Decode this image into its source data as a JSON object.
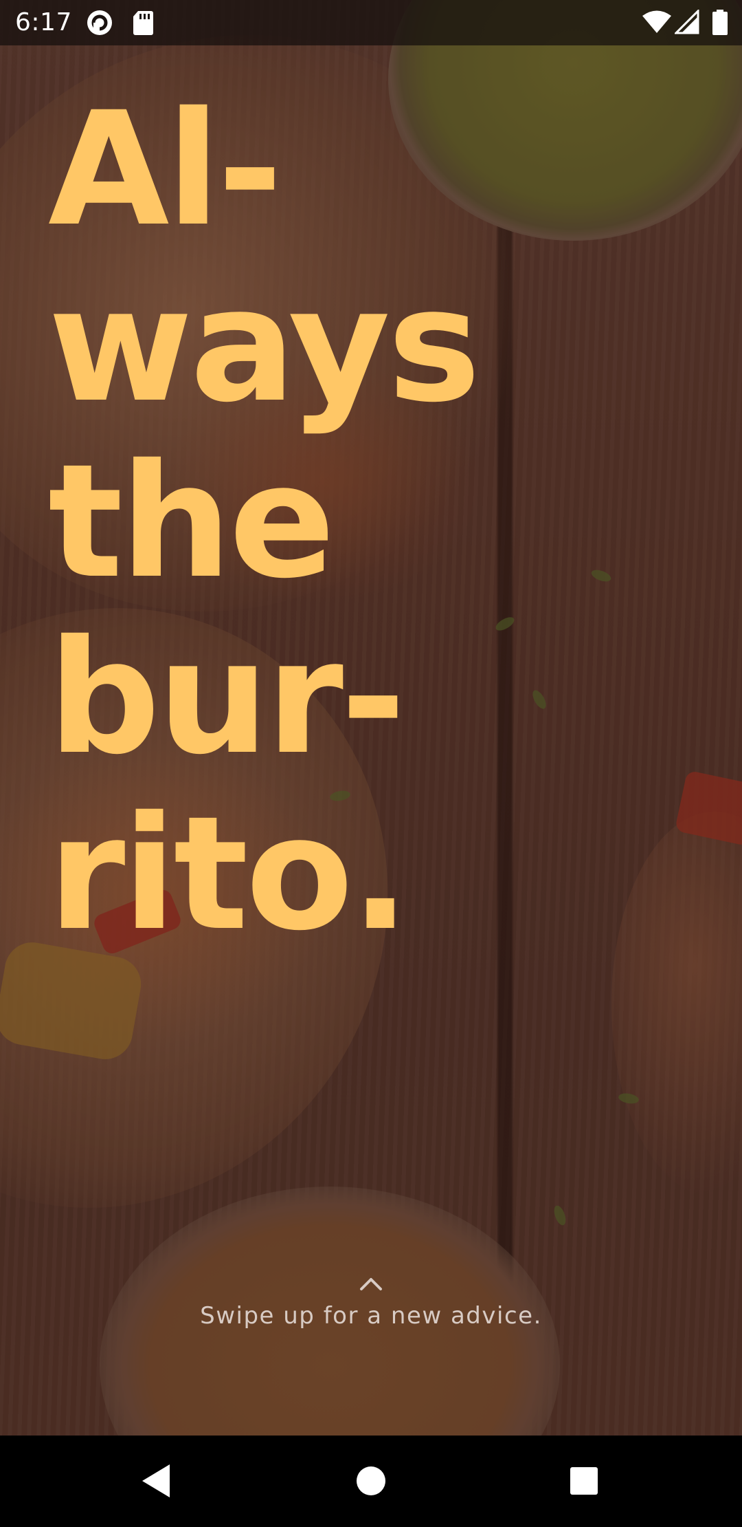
{
  "status_bar": {
    "time": "6:17",
    "left_icons": [
      "pocket-casts-icon",
      "sd-card-icon"
    ],
    "right_icons": [
      "wifi-icon",
      "cell-signal-icon",
      "battery-icon"
    ]
  },
  "headline": {
    "lines": [
      "Al-",
      "ways",
      "the",
      "bur-",
      "rito."
    ],
    "color": "#ffc766"
  },
  "swipe_hint": {
    "icon": "chevron-up-icon",
    "text": "Swipe up for a new advice."
  },
  "nav_bar": {
    "buttons": [
      "back-icon",
      "home-icon",
      "recents-icon"
    ]
  }
}
